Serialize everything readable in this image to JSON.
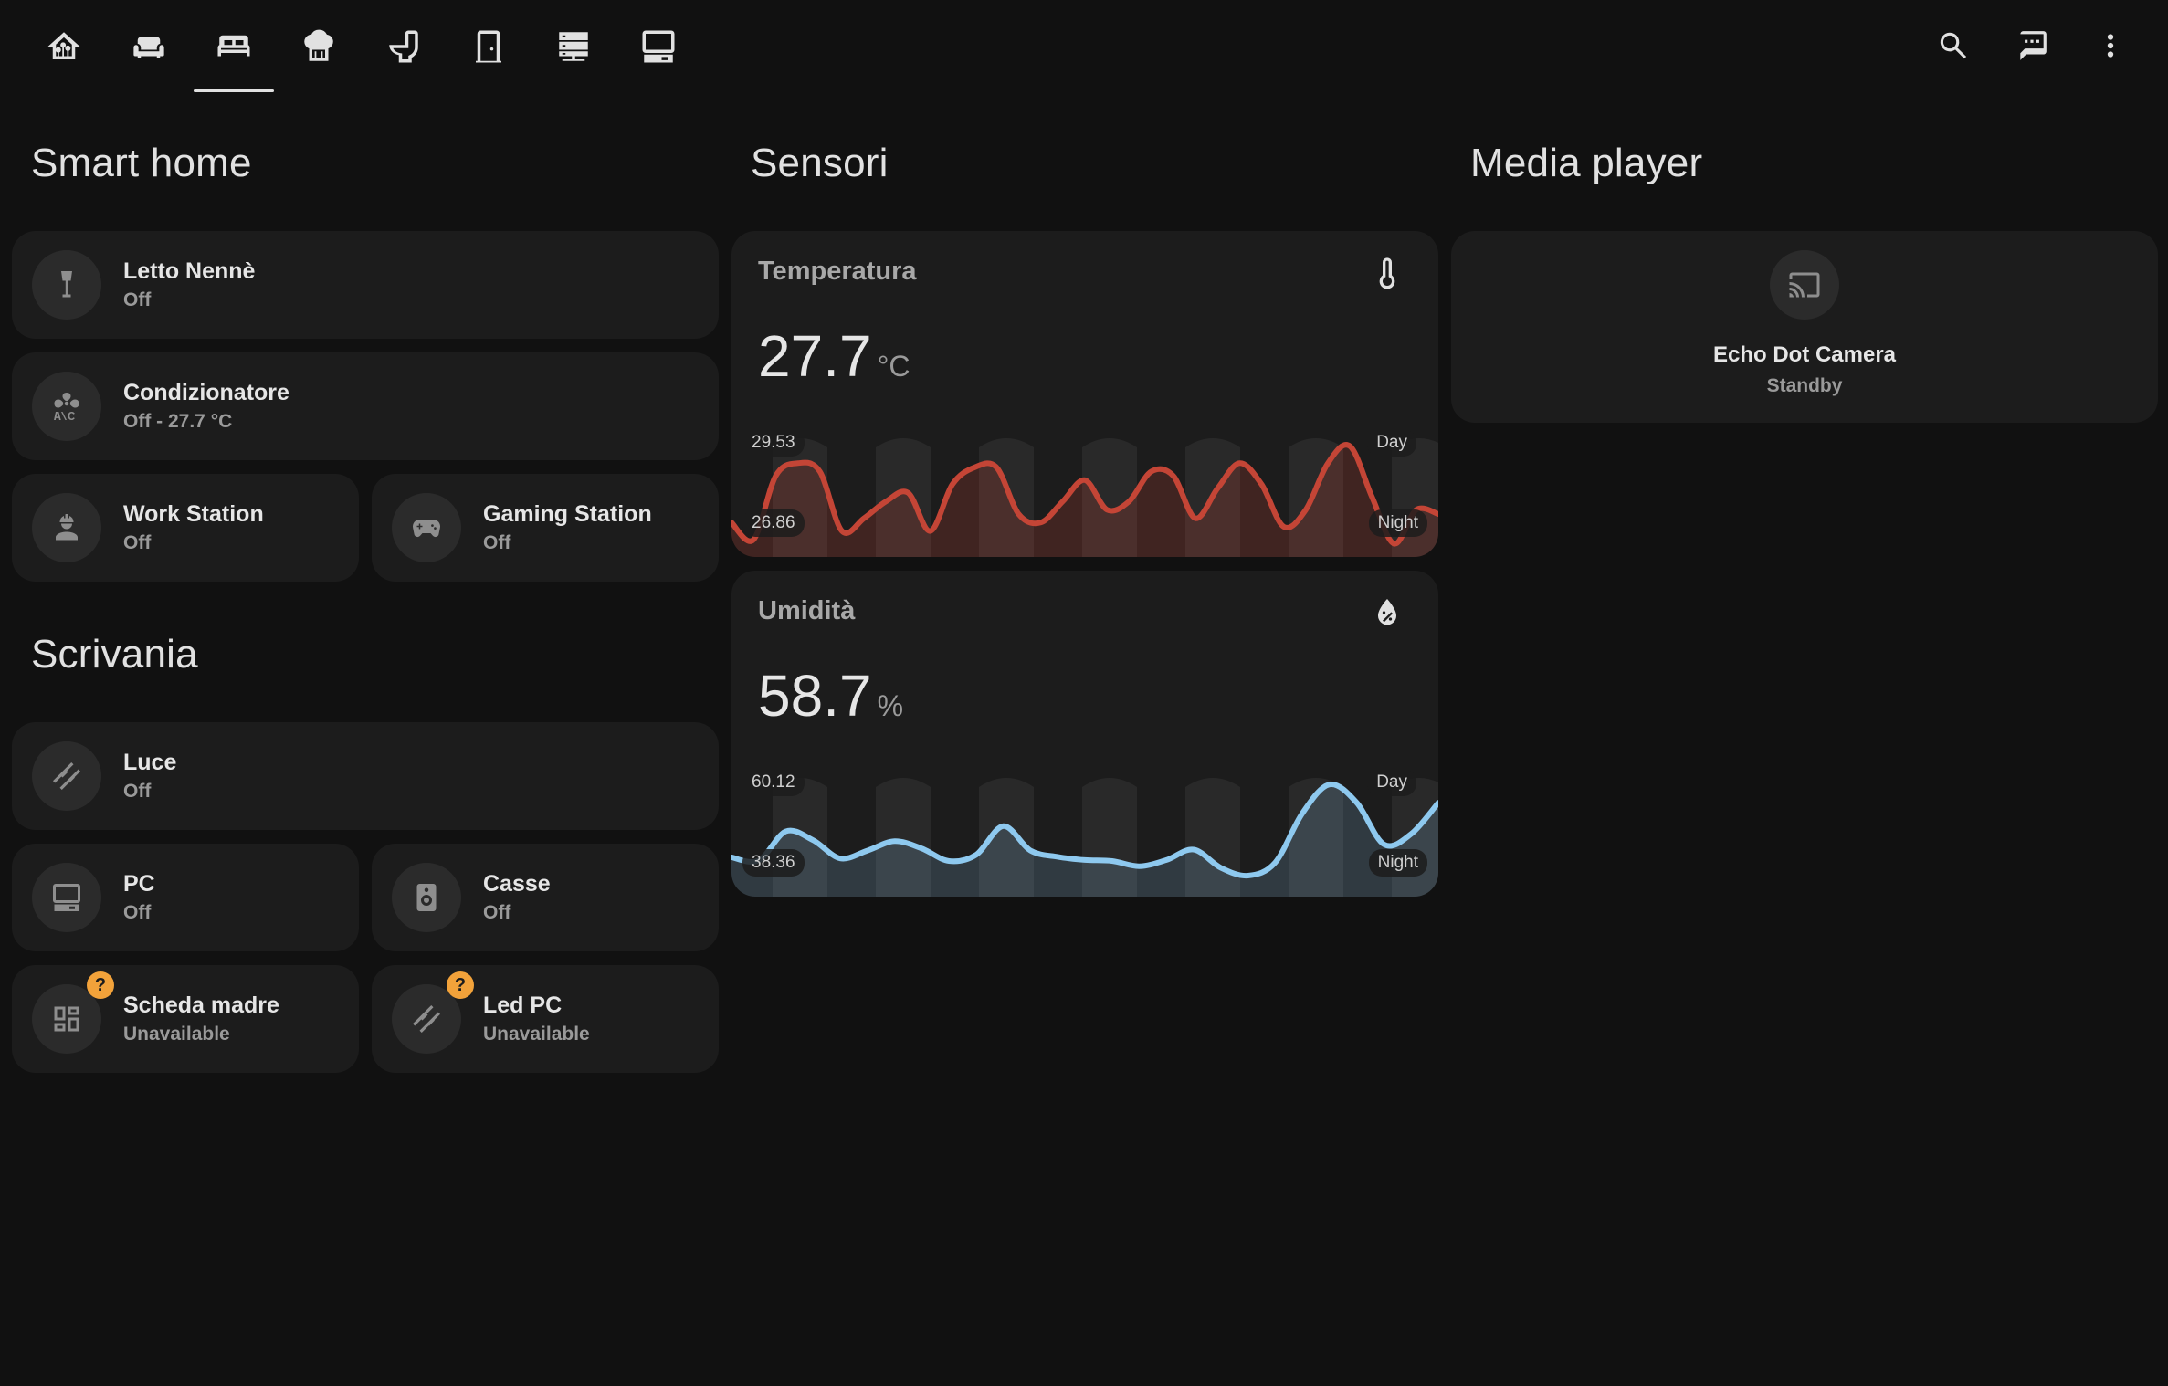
{
  "nav": {
    "tabs": [
      {
        "icon": "home-circuit-icon",
        "active": false
      },
      {
        "icon": "sofa-icon",
        "active": false
      },
      {
        "icon": "bed-icon",
        "active": true
      },
      {
        "icon": "chef-hat-icon",
        "active": false
      },
      {
        "icon": "toilet-icon",
        "active": false
      },
      {
        "icon": "door-icon",
        "active": false
      },
      {
        "icon": "server-icon",
        "active": false
      },
      {
        "icon": "desktop-tower-icon",
        "active": false
      }
    ],
    "actions": [
      "search-icon",
      "assist-chat-icon",
      "more-vert-icon"
    ]
  },
  "sections": {
    "smart_home": "Smart home",
    "scrivania": "Scrivania",
    "sensori": "Sensori",
    "media_player": "Media player"
  },
  "smart_home_tiles": [
    {
      "name": "Letto Nennè",
      "state": "Off",
      "icon": "floor-lamp-icon"
    },
    {
      "name": "Condizionatore",
      "state": "Off - 27.7 °C",
      "icon": "air-conditioner-icon"
    },
    {
      "name": "Work Station",
      "state": "Off",
      "icon": "account-hard-hat-icon"
    },
    {
      "name": "Gaming Station",
      "state": "Off",
      "icon": "gamepad-icon"
    }
  ],
  "scrivania_tiles": [
    {
      "name": "Luce",
      "state": "Off",
      "icon": "led-strip-icon"
    },
    {
      "name": "PC",
      "state": "Off",
      "icon": "desktop-tower-icon"
    },
    {
      "name": "Casse",
      "state": "Off",
      "icon": "speaker-icon"
    },
    {
      "name": "Scheda madre",
      "state": "Unavailable",
      "icon": "view-dashboard-icon",
      "badge": "?"
    },
    {
      "name": "Led PC",
      "state": "Unavailable",
      "icon": "led-strip-icon",
      "badge": "?"
    }
  ],
  "sensors": {
    "temperature": {
      "title": "Temperatura",
      "value": "27.7",
      "unit": "°C",
      "icon": "thermometer-icon",
      "max_label": "29.53",
      "min_label": "26.86",
      "day_label": "Day",
      "night_label": "Night",
      "color": "#c44536",
      "fill": "rgba(196,69,54,0.22)"
    },
    "humidity": {
      "title": "Umidità",
      "value": "58.7",
      "unit": "%",
      "icon": "water-percent-icon",
      "max_label": "60.12",
      "min_label": "38.36",
      "day_label": "Day",
      "night_label": "Night",
      "color": "#8ec9ef",
      "fill": "rgba(142,201,239,0.18)"
    }
  },
  "chart_data": [
    {
      "type": "area",
      "title": "Temperatura",
      "ylim": [
        26.86,
        29.53
      ],
      "values": [
        27.5,
        27.1,
        28.6,
        28.9,
        28.7,
        27.3,
        27.6,
        28.0,
        28.2,
        27.3,
        28.4,
        28.8,
        28.8,
        27.7,
        27.5,
        28.0,
        28.5,
        27.8,
        28.0,
        28.7,
        28.6,
        27.6,
        28.3,
        28.9,
        28.4,
        27.4,
        27.8,
        28.9,
        29.3,
        28.1,
        27.0,
        27.8,
        27.7
      ]
    },
    {
      "type": "area",
      "title": "Umidità",
      "ylim": [
        38.36,
        60.12
      ],
      "values": [
        44.5,
        43.9,
        49.5,
        47.8,
        44.3,
        45.8,
        47.6,
        46.2,
        43.8,
        45.0,
        50.5,
        45.8,
        44.6,
        44.0,
        43.8,
        42.8,
        44.0,
        46.0,
        42.5,
        41.0,
        43.5,
        53.0,
        58.5,
        55.0,
        47.0,
        49.0,
        55.0
      ]
    }
  ],
  "media": {
    "name": "Echo Dot Camera",
    "state": "Standby",
    "icon": "cast-icon"
  }
}
